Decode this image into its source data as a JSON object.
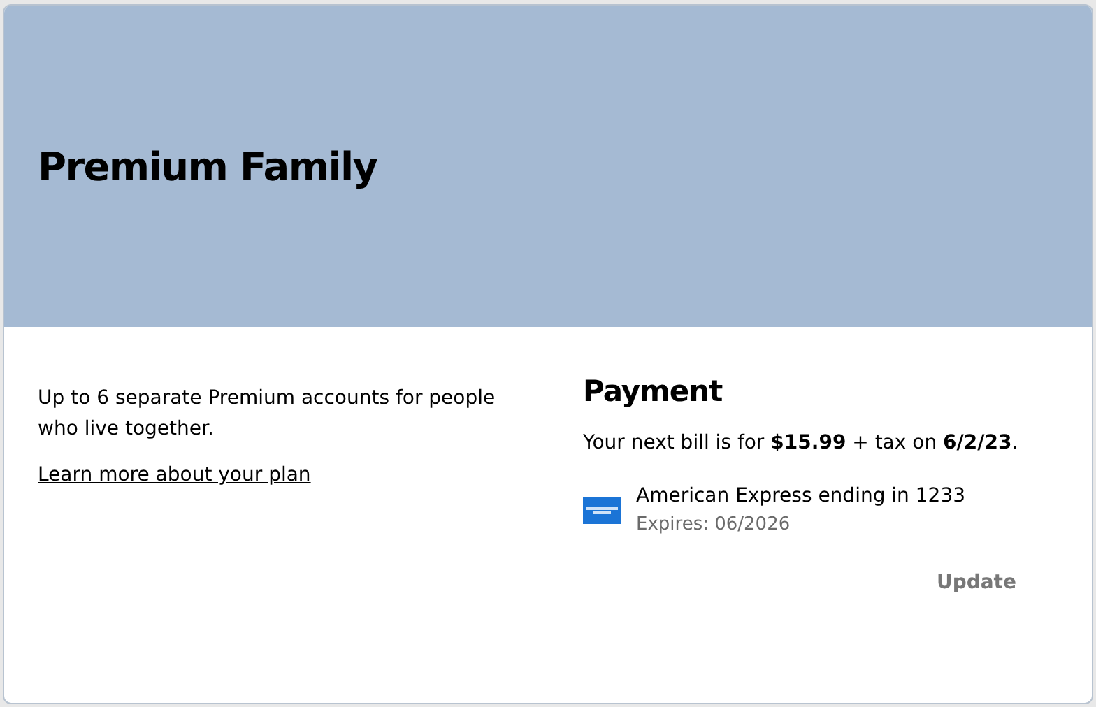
{
  "plan": {
    "title": "Premium Family",
    "description": "Up to 6 separate Premium accounts for people who live together.",
    "link": "Learn more about your plan"
  },
  "payment": {
    "title": "Payment",
    "bill": "Your next bill is for **$15.99** + tax on **6/2/23**.",
    "card": {
      "name": "American Express ending in 1233",
      "expires": "Expires: 06/2026"
    },
    "update_button": {
      "label": "Update",
      "disabled": true
    }
  }
}
